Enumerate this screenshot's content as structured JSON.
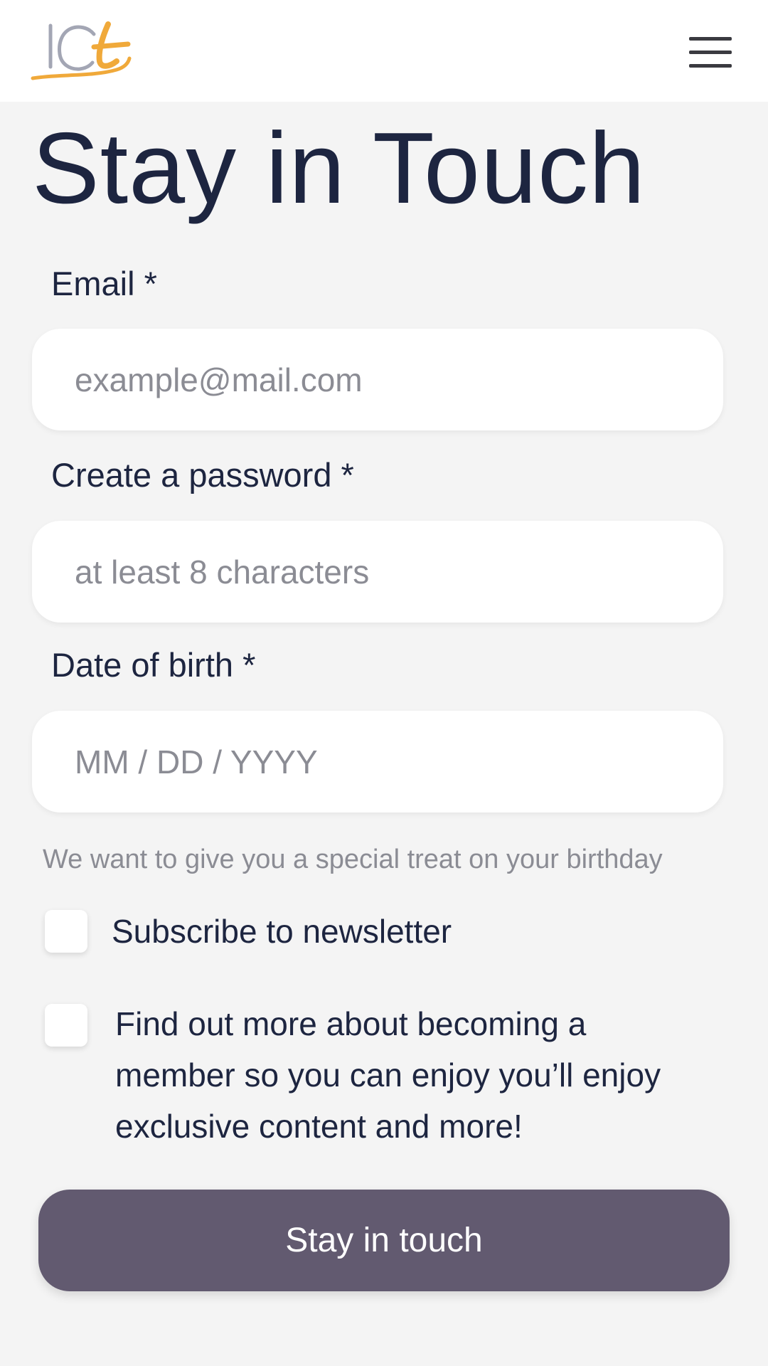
{
  "header": {
    "logo_text": "ICt",
    "menu_icon": "hamburger-menu-icon"
  },
  "page": {
    "title": "Stay in Touch"
  },
  "form": {
    "email": {
      "label": "Email *",
      "placeholder": "example@mail.com"
    },
    "password": {
      "label": "Create a password *",
      "placeholder": "at least 8 characters"
    },
    "dob": {
      "label": "Date of birth *",
      "placeholder": "MM / DD / YYYY",
      "hint": "We want to give you a special treat on your birthday"
    },
    "newsletter": {
      "label": "Subscribe to newsletter",
      "checked": false
    },
    "membership": {
      "label": "Find out more about becoming a member so you can enjoy you’ll enjoy exclusive content and more!",
      "checked": false
    },
    "submit_label": "Stay in touch"
  },
  "colors": {
    "background": "#f4f4f4",
    "header": "#ffffff",
    "text": "#1d2540",
    "placeholder": "#8b8c94",
    "button": "#625a70",
    "logo_gray": "#a3a6b4",
    "logo_orange": "#f0a93a"
  }
}
